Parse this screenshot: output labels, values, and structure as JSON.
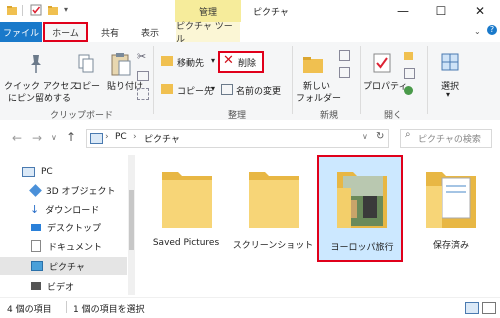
{
  "titlebar": {
    "context_tab": "管理",
    "window_title": "ピクチャ",
    "minimize": "—",
    "maximize": "☐",
    "close": "✕"
  },
  "tabs": {
    "file": "ファイル",
    "home": "ホーム",
    "share": "共有",
    "view": "表示",
    "picture_tools": "ピクチャ ツール"
  },
  "ribbon": {
    "pin_line1": "クイック アクセス",
    "pin_line2": "にピン留めする",
    "copy": "コピー",
    "paste": "貼り付け",
    "group_clipboard": "クリップボード",
    "move_to": "移動先",
    "copy_to": "コピー先",
    "delete": "削除",
    "rename": "名前の変更",
    "group_organize": "整理",
    "new_folder_line1": "新しい",
    "new_folder_line2": "フォルダー",
    "group_new": "新規",
    "properties": "プロパティ",
    "group_open": "開く",
    "select": "選択",
    "accent": "#1979ca",
    "highlight": "#e0001b"
  },
  "address": {
    "path_root": "PC",
    "path_leaf": "ピクチャ",
    "search_placeholder": "ピクチャの検索"
  },
  "nav_items": [
    "PC",
    "3D オブジェクト",
    "ダウンロード",
    "デスクトップ",
    "ドキュメント",
    "ピクチャ",
    "ビデオ"
  ],
  "files": [
    "Saved Pictures",
    "スクリーンショット",
    "ヨーロッパ旅行",
    "保存済み"
  ],
  "status": {
    "item_count": "4 個の項目",
    "selected": "1 個の項目を選択"
  }
}
